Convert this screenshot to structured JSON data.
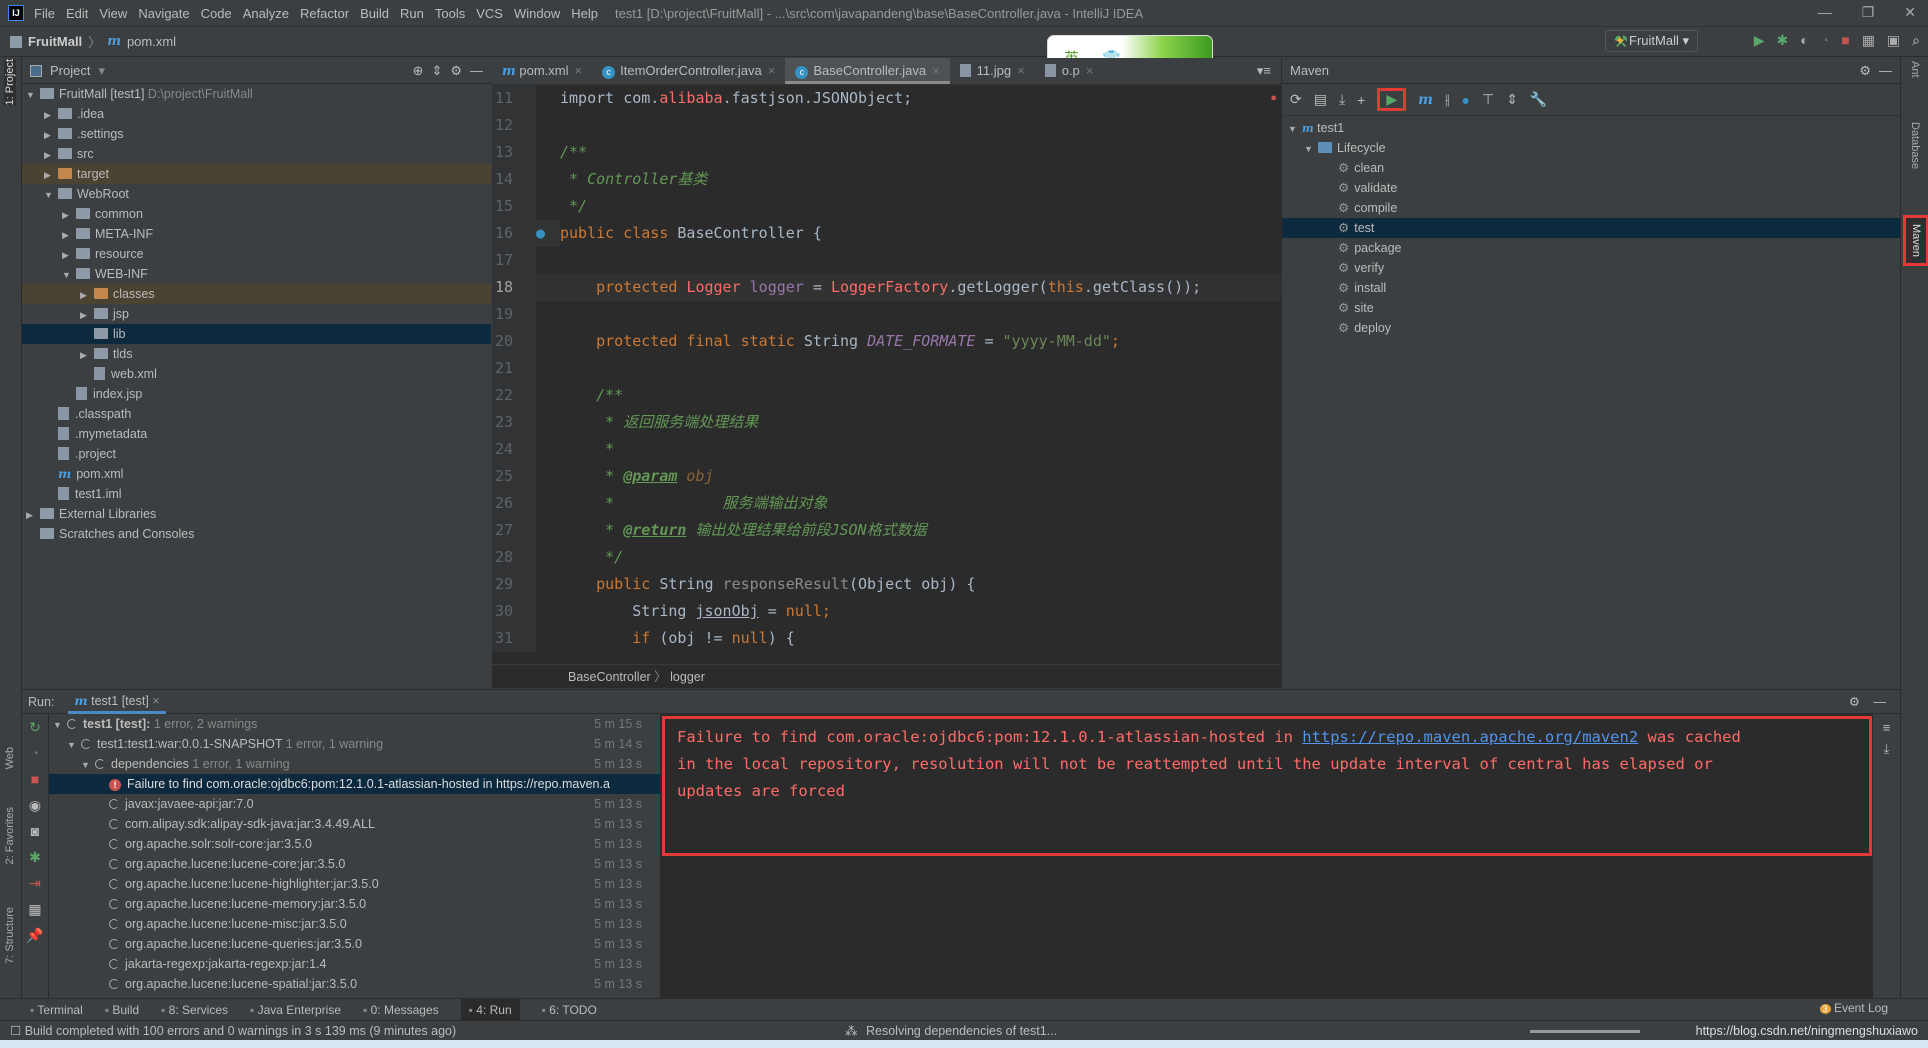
{
  "window": {
    "title": "test1 [D:\\project\\FruitMall] - ...\\src\\com\\javapandeng\\base\\BaseController.java - IntelliJ IDEA",
    "menu": [
      "File",
      "Edit",
      "View",
      "Navigate",
      "Code",
      "Analyze",
      "Refactor",
      "Build",
      "Run",
      "Tools",
      "VCS",
      "Window",
      "Help"
    ]
  },
  "navbar": {
    "project": "FruitMall",
    "file": "pom.xml",
    "run_config": "FruitMall"
  },
  "ime": {
    "text": "英 ， 👕"
  },
  "left_strip": {
    "project": "1: Project",
    "web": "Web",
    "favorites": "2: Favorites",
    "structure": "7: Structure"
  },
  "right_strip": {
    "ant": "Ant",
    "database": "Database",
    "maven": "Maven"
  },
  "project": {
    "title": "Project",
    "tree": [
      {
        "label": "FruitMall [test1]",
        "extra": "D:\\project\\FruitMall",
        "depth": 0,
        "arrow": "▼",
        "icon": "folder"
      },
      {
        "label": ".idea",
        "depth": 1,
        "arrow": "▶",
        "icon": "folder"
      },
      {
        "label": ".settings",
        "depth": 1,
        "arrow": "▶",
        "icon": "folder"
      },
      {
        "label": "src",
        "depth": 1,
        "arrow": "▶",
        "icon": "folder"
      },
      {
        "label": "target",
        "depth": 1,
        "arrow": "▶",
        "icon": "folder-orange",
        "hl": true
      },
      {
        "label": "WebRoot",
        "depth": 1,
        "arrow": "▼",
        "icon": "folder"
      },
      {
        "label": "common",
        "depth": 2,
        "arrow": "▶",
        "icon": "folder"
      },
      {
        "label": "META-INF",
        "depth": 2,
        "arrow": "▶",
        "icon": "folder"
      },
      {
        "label": "resource",
        "depth": 2,
        "arrow": "▶",
        "icon": "folder"
      },
      {
        "label": "WEB-INF",
        "depth": 2,
        "arrow": "▼",
        "icon": "folder"
      },
      {
        "label": "classes",
        "depth": 3,
        "arrow": "▶",
        "icon": "folder-orange",
        "hl": true
      },
      {
        "label": "jsp",
        "depth": 3,
        "arrow": "▶",
        "icon": "folder"
      },
      {
        "label": "lib",
        "depth": 3,
        "arrow": "",
        "icon": "folder",
        "sel": true
      },
      {
        "label": "tlds",
        "depth": 3,
        "arrow": "▶",
        "icon": "folder"
      },
      {
        "label": "web.xml",
        "depth": 3,
        "arrow": "",
        "icon": "file"
      },
      {
        "label": "index.jsp",
        "depth": 2,
        "arrow": "",
        "icon": "file"
      },
      {
        "label": ".classpath",
        "depth": 1,
        "arrow": "",
        "icon": "file"
      },
      {
        "label": ".mymetadata",
        "depth": 1,
        "arrow": "",
        "icon": "file"
      },
      {
        "label": ".project",
        "depth": 1,
        "arrow": "",
        "icon": "file"
      },
      {
        "label": "pom.xml",
        "depth": 1,
        "arrow": "",
        "icon": "maven"
      },
      {
        "label": "test1.iml",
        "depth": 1,
        "arrow": "",
        "icon": "file"
      },
      {
        "label": "External Libraries",
        "depth": 0,
        "arrow": "▶",
        "icon": "library"
      },
      {
        "label": "Scratches and Consoles",
        "depth": 0,
        "arrow": "",
        "icon": "scratch"
      }
    ]
  },
  "editor": {
    "tabs": [
      {
        "label": "pom.xml",
        "icon": "maven"
      },
      {
        "label": "ItemOrderController.java",
        "icon": "class"
      },
      {
        "label": "BaseController.java",
        "icon": "class",
        "active": true
      },
      {
        "label": "11.jpg",
        "icon": "image"
      },
      {
        "label": "o.p",
        "icon": "file"
      }
    ],
    "lines": [
      {
        "n": "11",
        "html": "<span class='pl'>import com.</span><span class='cls'>alibaba</span><span class='pl'>.fastjson.JSONObject;</span>"
      },
      {
        "n": "12",
        "html": ""
      },
      {
        "n": "13",
        "html": "<span class='cm'>/**</span>"
      },
      {
        "n": "14",
        "html": "<span class='cm'> * Controller基类</span>"
      },
      {
        "n": "15",
        "html": "<span class='cm'> */</span>"
      },
      {
        "n": "16",
        "html": "<span class='kw'>public class </span><span class='pl'>BaseController {</span>"
      },
      {
        "n": "17",
        "html": ""
      },
      {
        "n": "18",
        "html": "    <span class='kw'>protected </span><span class='cls'>Logger </span><span class='fld'>logger</span><span class='pl'> = </span><span class='cls'>LoggerFactory</span><span class='pl'>.getLogger(</span><span class='kw'>this</span><span class='pl'>.getClass());</span>"
      },
      {
        "n": "19",
        "html": ""
      },
      {
        "n": "20",
        "html": "    <span class='kw'>protected final static </span><span class='pl'>String </span><span class='fld' style='font-style:italic'>DATE_FORMATE</span><span class='pl'> = </span><span class='str'>\"yyyy-MM-dd\"</span><span class='kw'>;</span>"
      },
      {
        "n": "21",
        "html": ""
      },
      {
        "n": "22",
        "html": "    <span class='cm'>/**</span>"
      },
      {
        "n": "23",
        "html": "<span class='cm'>     * 返回服务端处理结果</span>"
      },
      {
        "n": "24",
        "html": "<span class='cm'>     *</span>"
      },
      {
        "n": "25",
        "html": "<span class='cm'>     * </span><span class='tag'>@param</span><span class='gr' style='color:#8a653b'> obj</span>"
      },
      {
        "n": "26",
        "html": "<span class='cm'>     *            服务端输出对象</span>"
      },
      {
        "n": "27",
        "html": "<span class='cm'>     * </span><span class='tag'>@return</span><span class='cm'> 输出处理结果给前段JSON格式数据</span>"
      },
      {
        "n": "28",
        "html": "<span class='cm'>     */</span>"
      },
      {
        "n": "29",
        "html": "    <span class='kw'>public </span><span class='pl'>String </span><span style='color:#8c8c8c'>responseResult</span><span class='pl'>(Object obj) {</span>"
      },
      {
        "n": "30",
        "html": "        <span class='pl'>String <u>jsonObj</u> = </span><span class='kw'>null;</span>"
      },
      {
        "n": "31",
        "html": "        <span class='kw'>if </span><span class='pl'>(obj != </span><span class='kw'>null</span><span class='pl'>) {</span>"
      }
    ],
    "breadcrumb": [
      "BaseController",
      "logger"
    ]
  },
  "maven": {
    "title": "Maven",
    "root": "test1",
    "lifecycle": "Lifecycle",
    "goals": [
      "clean",
      "validate",
      "compile",
      "test",
      "package",
      "verify",
      "install",
      "site",
      "deploy"
    ],
    "selected_goal": "test"
  },
  "run": {
    "label": "Run:",
    "tab": "test1 [test]",
    "tree": [
      {
        "label": "test1 [test]:",
        "note": "1 error, 2 warnings",
        "time": "5 m 15 s",
        "depth": 0,
        "arrow": "▼",
        "bold": true
      },
      {
        "label": "test1:test1:war:0.0.1-SNAPSHOT",
        "note": "1 error, 1 warning",
        "time": "5 m 14 s",
        "depth": 1,
        "arrow": "▼"
      },
      {
        "label": "dependencies",
        "note": "1 error, 1 warning",
        "time": "5 m 13 s",
        "depth": 2,
        "arrow": "▼"
      },
      {
        "label": "Failure to find com.oracle:ojdbc6:pom:12.1.0.1-atlassian-hosted in https://repo.maven.a",
        "note": "",
        "time": "",
        "depth": 3,
        "error": true,
        "sel": true
      },
      {
        "label": "javax:javaee-api:jar:7.0",
        "time": "5 m 13 s",
        "depth": 3
      },
      {
        "label": "com.alipay.sdk:alipay-sdk-java:jar:3.4.49.ALL",
        "time": "5 m 13 s",
        "depth": 3
      },
      {
        "label": "org.apache.solr:solr-core:jar:3.5.0",
        "time": "5 m 13 s",
        "depth": 3
      },
      {
        "label": "org.apache.lucene:lucene-core:jar:3.5.0",
        "time": "5 m 13 s",
        "depth": 3
      },
      {
        "label": "org.apache.lucene:lucene-highlighter:jar:3.5.0",
        "time": "5 m 13 s",
        "depth": 3
      },
      {
        "label": "org.apache.lucene:lucene-memory:jar:3.5.0",
        "time": "5 m 13 s",
        "depth": 3
      },
      {
        "label": "org.apache.lucene:lucene-misc:jar:3.5.0",
        "time": "5 m 13 s",
        "depth": 3
      },
      {
        "label": "org.apache.lucene:lucene-queries:jar:3.5.0",
        "time": "5 m 13 s",
        "depth": 3
      },
      {
        "label": "jakarta-regexp:jakarta-regexp:jar:1.4",
        "time": "5 m 13 s",
        "depth": 3
      },
      {
        "label": "org.apache.lucene:lucene-spatial:jar:3.5.0",
        "time": "5 m 13 s",
        "depth": 3
      }
    ],
    "output": {
      "line1_pre": "Failure to find com.oracle:ojdbc6:pom:12.1.0.1-atlassian-hosted in ",
      "link": "https://repo.maven.apache.org/maven2",
      "line1_post": " was cached",
      "line2": "in the local repository, resolution will not be reattempted until the update interval of central has elapsed or",
      "line3": "updates are forced"
    }
  },
  "bottom_tabs": [
    "Terminal",
    "Build",
    "8: Services",
    "Java Enterprise",
    "0: Messages",
    "4: Run",
    "6: TODO"
  ],
  "active_bottom_tab": "4: Run",
  "event_log": {
    "label": "Event Log",
    "count": "3"
  },
  "status": {
    "message": "Build completed with 100 errors and 0 warnings in 3 s 139 ms (9 minutes ago)",
    "progress": "Resolving dependencies of test1...",
    "watermark": "https://blog.csdn.net/ningmengshuxiawo"
  },
  "colors": {
    "error_red": "#e53935",
    "link": "#5394ec",
    "selection": "#0d293e"
  }
}
